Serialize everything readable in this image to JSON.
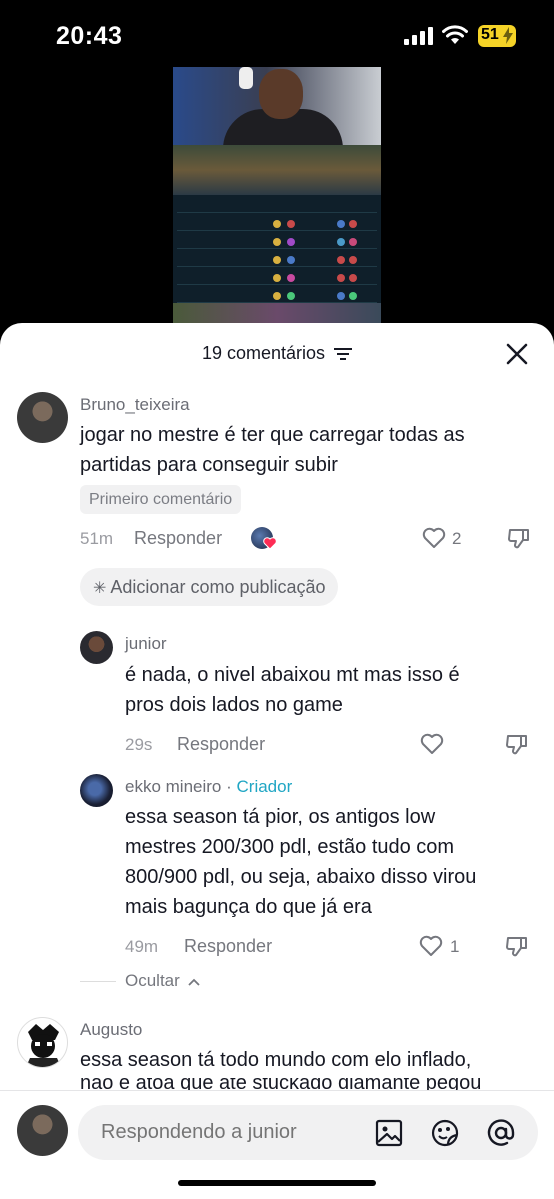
{
  "status": {
    "time": "20:43",
    "battery": "51"
  },
  "sheet": {
    "title": "19 comentários",
    "comments": [
      {
        "user": "Bruno_teixeira",
        "lines": [
          "jogar no mestre é ter que carregar todas as",
          "partidas para conseguir subir"
        ],
        "badge": "Primeiro comentário",
        "time": "51m",
        "reply": "Responder",
        "likes": "2",
        "add_publication": "Adicionar como publicação"
      },
      {
        "user": "junior",
        "lines": [
          "é nada, o nivel abaixou mt mas isso é",
          "pros dois lados no game"
        ],
        "time": "29s",
        "reply": "Responder"
      },
      {
        "user": "ekko mineiro",
        "separator": "·",
        "creator_label": "Criador",
        "lines": [
          "essa season tá pior, os antigos low",
          "mestres 200/300 pdl, estão tudo com",
          "800/900 pdl, ou seja, abaixo disso virou",
          "mais bagunça do que já era"
        ],
        "time": "49m",
        "reply": "Responder",
        "likes": "1"
      },
      {
        "user": "Augusto",
        "lines": [
          "essa season tá todo mundo com elo inflado,",
          "não é atoa que até stuckado diamante pegou"
        ]
      }
    ],
    "hide_label": "Ocultar"
  },
  "composer": {
    "placeholder": "Respondendo a junior"
  },
  "colors": {
    "creator": "#20a6c4",
    "like_badge": "#fe2c55",
    "battery": "#f5d327"
  }
}
